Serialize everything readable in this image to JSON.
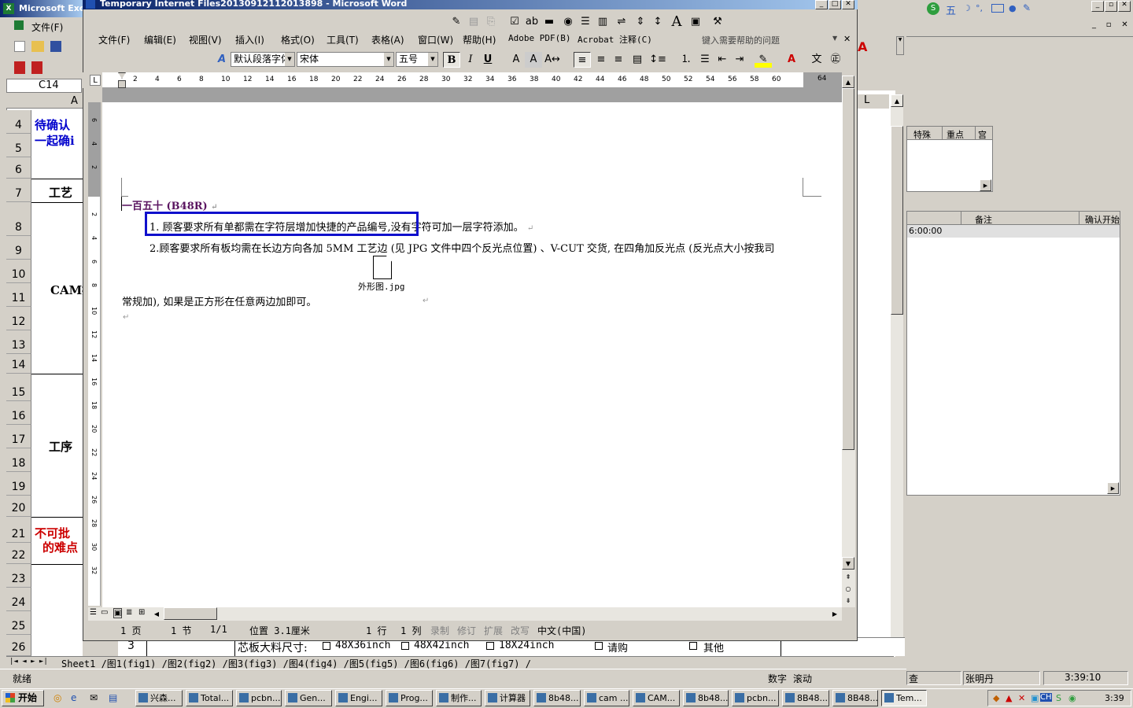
{
  "excel": {
    "title": "Microsoft Exce",
    "menu_file": "文件(F)",
    "namebox": "C14",
    "col_header": "A",
    "row_numbers": [
      "4",
      "5",
      "6",
      "7",
      "8",
      "9",
      "10",
      "11",
      "12",
      "13",
      "14",
      "15",
      "16",
      "17",
      "18",
      "19",
      "20",
      "21",
      "22",
      "23",
      "24",
      "25",
      "26"
    ],
    "cell_texts": {
      "r4": "待确认",
      "r5": "一起确i",
      "r7": "工艺",
      "r11": "CAM指",
      "r17": "工序",
      "r21": "不可批",
      "r22": "的难点"
    },
    "right_col_header": "L",
    "bottom_row": {
      "num": "3",
      "label": "芯板大料尺寸:",
      "options": [
        "48X36inch",
        "48X42inch",
        "18X24inch",
        "请购",
        "其他"
      ]
    },
    "sheet_tabs": "Sheet1 /图1(fig1) /图2(fig2) /图3(fig3) /图4(fig4) /图5(fig5) /图6(fig6) /图7(fig7) /",
    "status_ready": "就绪",
    "status_num": "数字",
    "status_scroll": "滚动"
  },
  "right_app": {
    "col_headers_1": [
      "特殊",
      "重点",
      "宫"
    ],
    "col_headers_2": [
      "备注",
      "确认开始"
    ],
    "time_value": "6:00:00",
    "status_1": "查",
    "status_2": "张明丹",
    "status_3": "3:39:10",
    "ime_label": "五"
  },
  "word": {
    "title": "Temporary Internet Files20130912112013898 - Microsoft Word",
    "menu": [
      "文件(F)",
      "编辑(E)",
      "视图(V)",
      "插入(I)",
      "格式(O)",
      "工具(T)",
      "表格(A)",
      "窗口(W)",
      "帮助(H)",
      "Adobe PDF(B)",
      "Acrobat 注释(C)"
    ],
    "help_placeholder": "键入需要帮助的问题",
    "style_combo": "默认段落字体",
    "font_combo": "宋体",
    "size_combo": "五号",
    "ruler_end": "64",
    "doc": {
      "heading": "一百五十 (B48R)",
      "item1_highlighted": "1. 顾客要求所有单都需在字符层增加快捷的产品编号,",
      "item1_rest": "没有字符可加一层字符添加。",
      "item2": "2.顾客要求所有板均需在长边方向各加 5MM 工艺边 (见 JPG 文件中四个反光点位置) 、V-CUT 交货, 在四角加反光点 (反光点大小按我司",
      "file_caption": "外形图.jpg",
      "item2_cont": "常规加), 如果是正方形在任意两边加即可。"
    },
    "status": {
      "page": "1 页",
      "section": "1 节",
      "pages": "1/1",
      "position": "位置 3.1厘米",
      "line": "1 行",
      "column": "1 列",
      "rec": "录制",
      "trk": "修订",
      "ext": "扩展",
      "ovr": "改写",
      "lang": "中文(中国)"
    }
  },
  "taskbar": {
    "start": "开始",
    "tasks": [
      "兴森...",
      "Total...",
      "pcbn...",
      "Gen...",
      "Engi...",
      "Prog...",
      "制作...",
      "计算器",
      "8b48...",
      "cam ...",
      "CAM...",
      "8b48...",
      "pcbn...",
      "8B48...",
      "8B48...",
      "Tem..."
    ],
    "clock": "3:39"
  },
  "colors": {
    "title_gradient_start": "#0a246a",
    "highlight_box": "#1010cc",
    "heading_text": "#5a1460",
    "red_text": "#cc0000",
    "blue_text": "#0000cc"
  }
}
